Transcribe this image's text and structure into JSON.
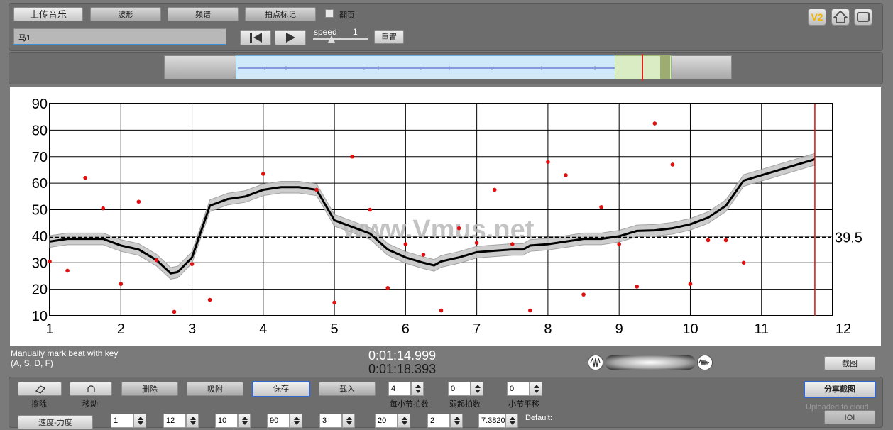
{
  "toolbar": {
    "upload": "上传音乐",
    "waveform": "波形",
    "spectrum": "频谱",
    "beat_mark": "拍点标记",
    "page_flip": "翻页",
    "speed_label": "speed",
    "speed_value": "1",
    "reset": "重置",
    "song_name": "马1",
    "v2": "V2"
  },
  "chart_data": {
    "type": "line",
    "xlim": [
      1,
      12
    ],
    "ylim": [
      10,
      90
    ],
    "x_ticks": [
      "1",
      "2",
      "3",
      "4",
      "5",
      "6",
      "7",
      "8",
      "9",
      "10",
      "11",
      "12"
    ],
    "y_ticks": [
      "90",
      "80",
      "70",
      "60",
      "50",
      "40",
      "30",
      "20",
      "10"
    ],
    "reference_value": "39.5",
    "reference_y": 39.5,
    "marker_x": 11.75,
    "watermark": "www.Vmus.net",
    "curve": [
      [
        1,
        38
      ],
      [
        1.25,
        39
      ],
      [
        1.75,
        39
      ],
      [
        2,
        36.5
      ],
      [
        2.25,
        35
      ],
      [
        2.5,
        31
      ],
      [
        2.7,
        26
      ],
      [
        2.8,
        26.5
      ],
      [
        3,
        32
      ],
      [
        3.25,
        51.5
      ],
      [
        3.5,
        54
      ],
      [
        3.75,
        55
      ],
      [
        4,
        57.5
      ],
      [
        4.25,
        58.5
      ],
      [
        4.5,
        58.5
      ],
      [
        4.75,
        57.5
      ],
      [
        5,
        46
      ],
      [
        5.25,
        43.5
      ],
      [
        5.5,
        41
      ],
      [
        5.75,
        35
      ],
      [
        6,
        32
      ],
      [
        6.25,
        30
      ],
      [
        6.4,
        29
      ],
      [
        6.5,
        30.5
      ],
      [
        6.75,
        32
      ],
      [
        7,
        34
      ],
      [
        7.25,
        34.5
      ],
      [
        7.5,
        35
      ],
      [
        7.65,
        35
      ],
      [
        7.75,
        36.5
      ],
      [
        8,
        37
      ],
      [
        8.25,
        38
      ],
      [
        8.5,
        39
      ],
      [
        8.75,
        39
      ],
      [
        9,
        40
      ],
      [
        9.25,
        42
      ],
      [
        9.5,
        42.2
      ],
      [
        9.75,
        43
      ],
      [
        10,
        44.5
      ],
      [
        10.25,
        47
      ],
      [
        10.5,
        51.5
      ],
      [
        10.75,
        61
      ],
      [
        11,
        63
      ],
      [
        11.25,
        65
      ],
      [
        11.5,
        67
      ],
      [
        11.75,
        69
      ]
    ],
    "points": [
      [
        1,
        30.5
      ],
      [
        1.25,
        27
      ],
      [
        1.5,
        62
      ],
      [
        1.75,
        50.5
      ],
      [
        2,
        22
      ],
      [
        2.25,
        53
      ],
      [
        2.5,
        31
      ],
      [
        2.75,
        11.5
      ],
      [
        3,
        29.5
      ],
      [
        3.25,
        16
      ],
      [
        4,
        63.5
      ],
      [
        4.75,
        57.5
      ],
      [
        5,
        15
      ],
      [
        5.25,
        70
      ],
      [
        5.5,
        50
      ],
      [
        5.75,
        20.5
      ],
      [
        6,
        37
      ],
      [
        6.25,
        33
      ],
      [
        6.5,
        12
      ],
      [
        6.75,
        43
      ],
      [
        7,
        37.5
      ],
      [
        7.25,
        57.5
      ],
      [
        7.5,
        37
      ],
      [
        7.75,
        12
      ],
      [
        8,
        68
      ],
      [
        8.25,
        63
      ],
      [
        8.5,
        18
      ],
      [
        8.75,
        51
      ],
      [
        9,
        37
      ],
      [
        9.25,
        21
      ],
      [
        9.5,
        82.5
      ],
      [
        9.75,
        67
      ],
      [
        10,
        22
      ],
      [
        10.25,
        38.5
      ],
      [
        10.5,
        38.5
      ],
      [
        10.75,
        30
      ]
    ]
  },
  "time": {
    "current": "0:01:14.999",
    "total": "0:01:18.393"
  },
  "hint": {
    "line1": "Manually mark beat with key",
    "line2": "(A, S, D, F)"
  },
  "bottom": {
    "screenshot": "截图",
    "erase": "擦除",
    "move": "移动",
    "delete": "删除",
    "snap": "吸附",
    "save": "保存",
    "load": "载入",
    "beats_per_bar": "4",
    "beats_per_bar_label": "每小节拍数",
    "pickup": "0",
    "pickup_label": "弱起拍数",
    "bar_shift": "0",
    "bar_shift_label": "小节平移",
    "share": "分享截图",
    "uploaded": "Uploaded to cloud",
    "speed_force": "速度-力度",
    "row2": [
      "1",
      "12",
      "10",
      "90",
      "3",
      "20",
      "2",
      "7.3820"
    ],
    "default": "Default:",
    "ioi": "IOI"
  }
}
